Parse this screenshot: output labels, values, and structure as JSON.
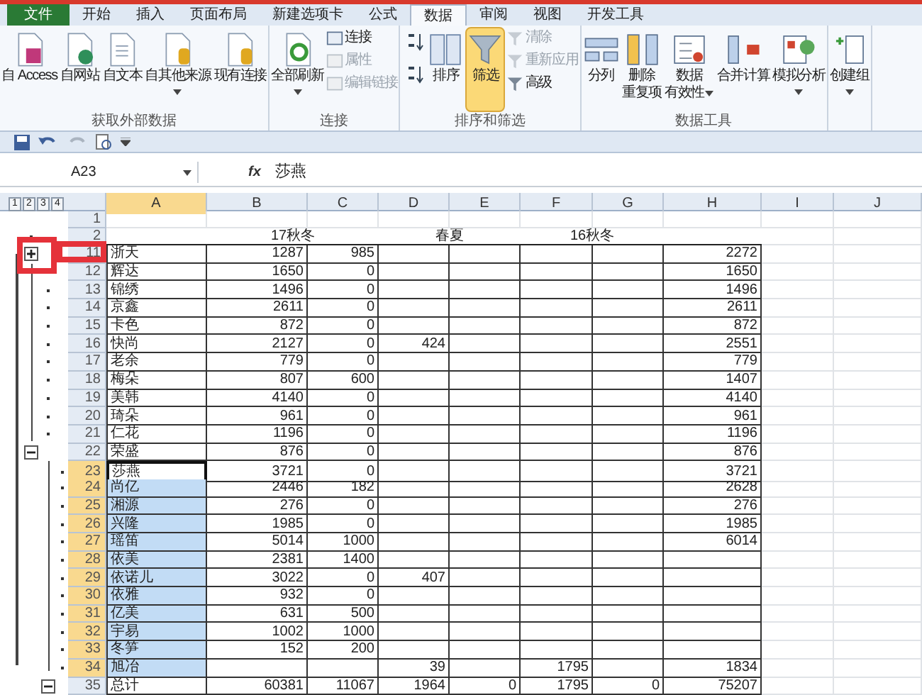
{
  "ribbon": {
    "tabs": [
      {
        "label": "文件",
        "kind": "file",
        "selected": false
      },
      {
        "label": "开始",
        "kind": "tab",
        "selected": false
      },
      {
        "label": "插入",
        "kind": "tab",
        "selected": false
      },
      {
        "label": "页面布局",
        "kind": "tab",
        "selected": false
      },
      {
        "label": "新建选项卡",
        "kind": "tab",
        "selected": false
      },
      {
        "label": "公式",
        "kind": "tab",
        "selected": false
      },
      {
        "label": "数据",
        "kind": "tab",
        "selected": true
      },
      {
        "label": "审阅",
        "kind": "tab",
        "selected": false
      },
      {
        "label": "视图",
        "kind": "tab",
        "selected": false
      },
      {
        "label": "开发工具",
        "kind": "tab",
        "selected": false
      }
    ],
    "groups": [
      {
        "label": "获取外部数据",
        "columns": [
          [
            {
              "kind": "large",
              "label": "自 Access",
              "dropdown": false,
              "disabled": false,
              "active": false
            }
          ],
          [
            {
              "kind": "large",
              "label": "自网站",
              "dropdown": false,
              "disabled": false,
              "active": false
            }
          ],
          [
            {
              "kind": "large",
              "label": "自文本",
              "dropdown": false,
              "disabled": false,
              "active": false
            }
          ],
          [
            {
              "kind": "large",
              "label": "自其他来源",
              "dropdown": true,
              "disabled": false,
              "active": false
            }
          ],
          [
            {
              "kind": "large",
              "label": "现有连接",
              "dropdown": false,
              "disabled": false,
              "active": false
            }
          ]
        ]
      },
      {
        "label": "连接",
        "columns": [
          [
            {
              "kind": "large",
              "label": "全部刷新",
              "dropdown": true,
              "disabled": false,
              "active": false
            }
          ],
          [
            {
              "kind": "small",
              "label": "连接",
              "dropdown": false,
              "disabled": false,
              "active": false
            },
            {
              "kind": "small",
              "label": "属性",
              "dropdown": false,
              "disabled": true,
              "active": false
            },
            {
              "kind": "small",
              "label": "编辑链接",
              "dropdown": false,
              "disabled": true,
              "active": false
            }
          ]
        ]
      },
      {
        "label": "排序和筛选",
        "columns": [
          [
            {
              "kind": "icon",
              "dropdown": false,
              "disabled": false,
              "active": false
            },
            {
              "kind": "icon",
              "dropdown": false,
              "disabled": false,
              "active": false
            }
          ],
          [
            {
              "kind": "large",
              "label": "排序",
              "dropdown": false,
              "disabled": false,
              "active": false
            }
          ],
          [
            {
              "kind": "large",
              "label": "筛选",
              "dropdown": false,
              "disabled": false,
              "active": true
            }
          ],
          [
            {
              "kind": "small",
              "label": "清除",
              "dropdown": false,
              "disabled": true,
              "active": false
            },
            {
              "kind": "small",
              "label": "重新应用",
              "dropdown": false,
              "disabled": true,
              "active": false
            },
            {
              "kind": "small",
              "label": "高级",
              "dropdown": false,
              "disabled": false,
              "active": false
            }
          ]
        ]
      },
      {
        "label": "数据工具",
        "columns": [
          [
            {
              "kind": "large",
              "label": "分列",
              "dropdown": false,
              "disabled": false,
              "active": false
            }
          ],
          [
            {
              "kind": "large",
              "label": "删除",
              "label_2": "重复项",
              "dropdown": false,
              "disabled": false,
              "active": false
            }
          ],
          [
            {
              "kind": "large",
              "label": "数据",
              "label_2": "有效性",
              "dropdown": true,
              "disabled": false,
              "active": false
            }
          ],
          [
            {
              "kind": "large",
              "label": "合并计算",
              "dropdown": false,
              "disabled": false,
              "active": false
            }
          ],
          [
            {
              "kind": "large",
              "label": "模拟分析",
              "dropdown": true,
              "disabled": false,
              "active": false
            }
          ]
        ]
      },
      {
        "columns": [
          [
            {
              "kind": "large",
              "label": "创建组",
              "dropdown": true,
              "disabled": false,
              "active": false
            }
          ]
        ]
      }
    ]
  },
  "formula_bar": {
    "cell_name": "A23",
    "fx": "fx",
    "value": "莎燕"
  },
  "sheet": {
    "outline_levels": [
      "1",
      "2",
      "3",
      "4"
    ],
    "columns": [
      {
        "label": "A",
        "selected": true
      },
      {
        "label": "B",
        "selected": false
      },
      {
        "label": "C",
        "selected": false
      },
      {
        "label": "D",
        "selected": false
      },
      {
        "label": "E",
        "selected": false
      },
      {
        "label": "F",
        "selected": false
      },
      {
        "label": "G",
        "selected": false
      },
      {
        "label": "H",
        "selected": false
      },
      {
        "label": "I",
        "selected": false
      },
      {
        "label": "J",
        "selected": false
      }
    ],
    "rows": [
      {
        "num": "1",
        "kind": "blank",
        "selected": false,
        "active": false
      },
      {
        "num": "2",
        "kind": "header",
        "selected": false,
        "active": false,
        "outline": {
          "kind": "dot2"
        },
        "groups": [
          "17秋冬",
          "春夏",
          "16秋冬"
        ]
      },
      {
        "num": "11",
        "kind": "data",
        "selected": false,
        "active": false,
        "outline": {
          "kind": "plus2"
        },
        "cells": {
          "a": "浙天",
          "b": "1287",
          "c": "985",
          "h": "2272"
        }
      },
      {
        "num": "12",
        "kind": "data",
        "selected": false,
        "active": false,
        "cells": {
          "a": "辉达",
          "b": "1650",
          "c": "0",
          "h": "1650"
        }
      },
      {
        "num": "13",
        "kind": "data",
        "selected": false,
        "active": false,
        "outline": {
          "kind": "dot3"
        },
        "cells": {
          "a": "锦绣",
          "b": "1496",
          "c": "0",
          "h": "1496"
        }
      },
      {
        "num": "14",
        "kind": "data",
        "selected": false,
        "active": false,
        "outline": {
          "kind": "dot3"
        },
        "cells": {
          "a": "京鑫",
          "b": "2611",
          "c": "0",
          "h": "2611"
        }
      },
      {
        "num": "15",
        "kind": "data",
        "selected": false,
        "active": false,
        "outline": {
          "kind": "dot3"
        },
        "cells": {
          "a": "卡色",
          "b": "872",
          "c": "0",
          "h": "872"
        }
      },
      {
        "num": "16",
        "kind": "data",
        "selected": false,
        "active": false,
        "outline": {
          "kind": "dot3"
        },
        "cells": {
          "a": "快尚",
          "b": "2127",
          "c": "0",
          "d": "424",
          "h": "2551"
        }
      },
      {
        "num": "17",
        "kind": "data",
        "selected": false,
        "active": false,
        "outline": {
          "kind": "dot3"
        },
        "cells": {
          "a": "老余",
          "b": "779",
          "c": "0",
          "h": "779"
        }
      },
      {
        "num": "18",
        "kind": "data",
        "selected": false,
        "active": false,
        "outline": {
          "kind": "dot3"
        },
        "cells": {
          "a": "梅朵",
          "b": "807",
          "c": "600",
          "h": "1407"
        }
      },
      {
        "num": "19",
        "kind": "data",
        "selected": false,
        "active": false,
        "outline": {
          "kind": "dot3"
        },
        "cells": {
          "a": "美韩",
          "b": "4140",
          "c": "0",
          "h": "4140"
        }
      },
      {
        "num": "20",
        "kind": "data",
        "selected": false,
        "active": false,
        "outline": {
          "kind": "dot3"
        },
        "cells": {
          "a": "琦朵",
          "b": "961",
          "c": "0",
          "h": "961"
        }
      },
      {
        "num": "21",
        "kind": "data",
        "selected": false,
        "active": false,
        "outline": {
          "kind": "dot3"
        },
        "cells": {
          "a": "仁花",
          "b": "1196",
          "c": "0",
          "h": "1196"
        }
      },
      {
        "num": "22",
        "kind": "data",
        "selected": false,
        "active": false,
        "outline": {
          "kind": "minus2"
        },
        "cells": {
          "a": "荣盛",
          "b": "876",
          "c": "0",
          "h": "876"
        }
      },
      {
        "num": "23",
        "kind": "data",
        "selected": true,
        "active": true,
        "outline": {
          "kind": "dot4"
        },
        "cells": {
          "a": "莎燕",
          "b": "3721",
          "c": "0",
          "h": "3721"
        }
      },
      {
        "num": "24",
        "kind": "data",
        "selected": true,
        "active": false,
        "outline": {
          "kind": "dot4"
        },
        "cells": {
          "a": "尚亿",
          "b": "2446",
          "c": "182",
          "h": "2628"
        }
      },
      {
        "num": "25",
        "kind": "data",
        "selected": true,
        "active": false,
        "outline": {
          "kind": "dot4"
        },
        "cells": {
          "a": "湘源",
          "b": "276",
          "c": "0",
          "h": "276"
        }
      },
      {
        "num": "26",
        "kind": "data",
        "selected": true,
        "active": false,
        "outline": {
          "kind": "dot4"
        },
        "cells": {
          "a": "兴隆",
          "b": "1985",
          "c": "0",
          "h": "1985"
        }
      },
      {
        "num": "27",
        "kind": "data",
        "selected": true,
        "active": false,
        "outline": {
          "kind": "dot4"
        },
        "cells": {
          "a": "瑶笛",
          "b": "5014",
          "c": "1000",
          "h": "6014"
        }
      },
      {
        "num": "28",
        "kind": "data",
        "selected": true,
        "active": false,
        "outline": {
          "kind": "dot4"
        },
        "cells": {
          "a": "依美",
          "b": "2381",
          "c": "1400"
        }
      },
      {
        "num": "29",
        "kind": "data",
        "selected": true,
        "active": false,
        "outline": {
          "kind": "dot4"
        },
        "cells": {
          "a": "依诺儿",
          "b": "3022",
          "c": "0",
          "d": "407"
        }
      },
      {
        "num": "30",
        "kind": "data",
        "selected": true,
        "active": false,
        "outline": {
          "kind": "dot4"
        },
        "cells": {
          "a": "依雅",
          "b": "932",
          "c": "0"
        }
      },
      {
        "num": "31",
        "kind": "data",
        "selected": true,
        "active": false,
        "outline": {
          "kind": "dot4"
        },
        "cells": {
          "a": "亿美",
          "b": "631",
          "c": "500"
        }
      },
      {
        "num": "32",
        "kind": "data",
        "selected": true,
        "active": false,
        "outline": {
          "kind": "dot4"
        },
        "cells": {
          "a": "宇易",
          "b": "1002",
          "c": "1000"
        }
      },
      {
        "num": "33",
        "kind": "data",
        "selected": true,
        "active": false,
        "outline": {
          "kind": "dot4"
        },
        "cells": {
          "a": "冬笋",
          "b": "152",
          "c": "200"
        }
      },
      {
        "num": "34",
        "kind": "data",
        "selected": true,
        "active": false,
        "outline": {
          "kind": "dot4"
        },
        "cells": {
          "a": "旭冶",
          "d": "39",
          "f": "1795",
          "h": "1834"
        }
      },
      {
        "num": "35",
        "kind": "data",
        "selected": false,
        "active": false,
        "outline": {
          "kind": "minus3"
        },
        "cells": {
          "a": "总计",
          "b": "60381",
          "c": "11067",
          "d": "1964",
          "e": "0",
          "f": "1795",
          "g": "0",
          "h": "75207"
        }
      }
    ]
  }
}
